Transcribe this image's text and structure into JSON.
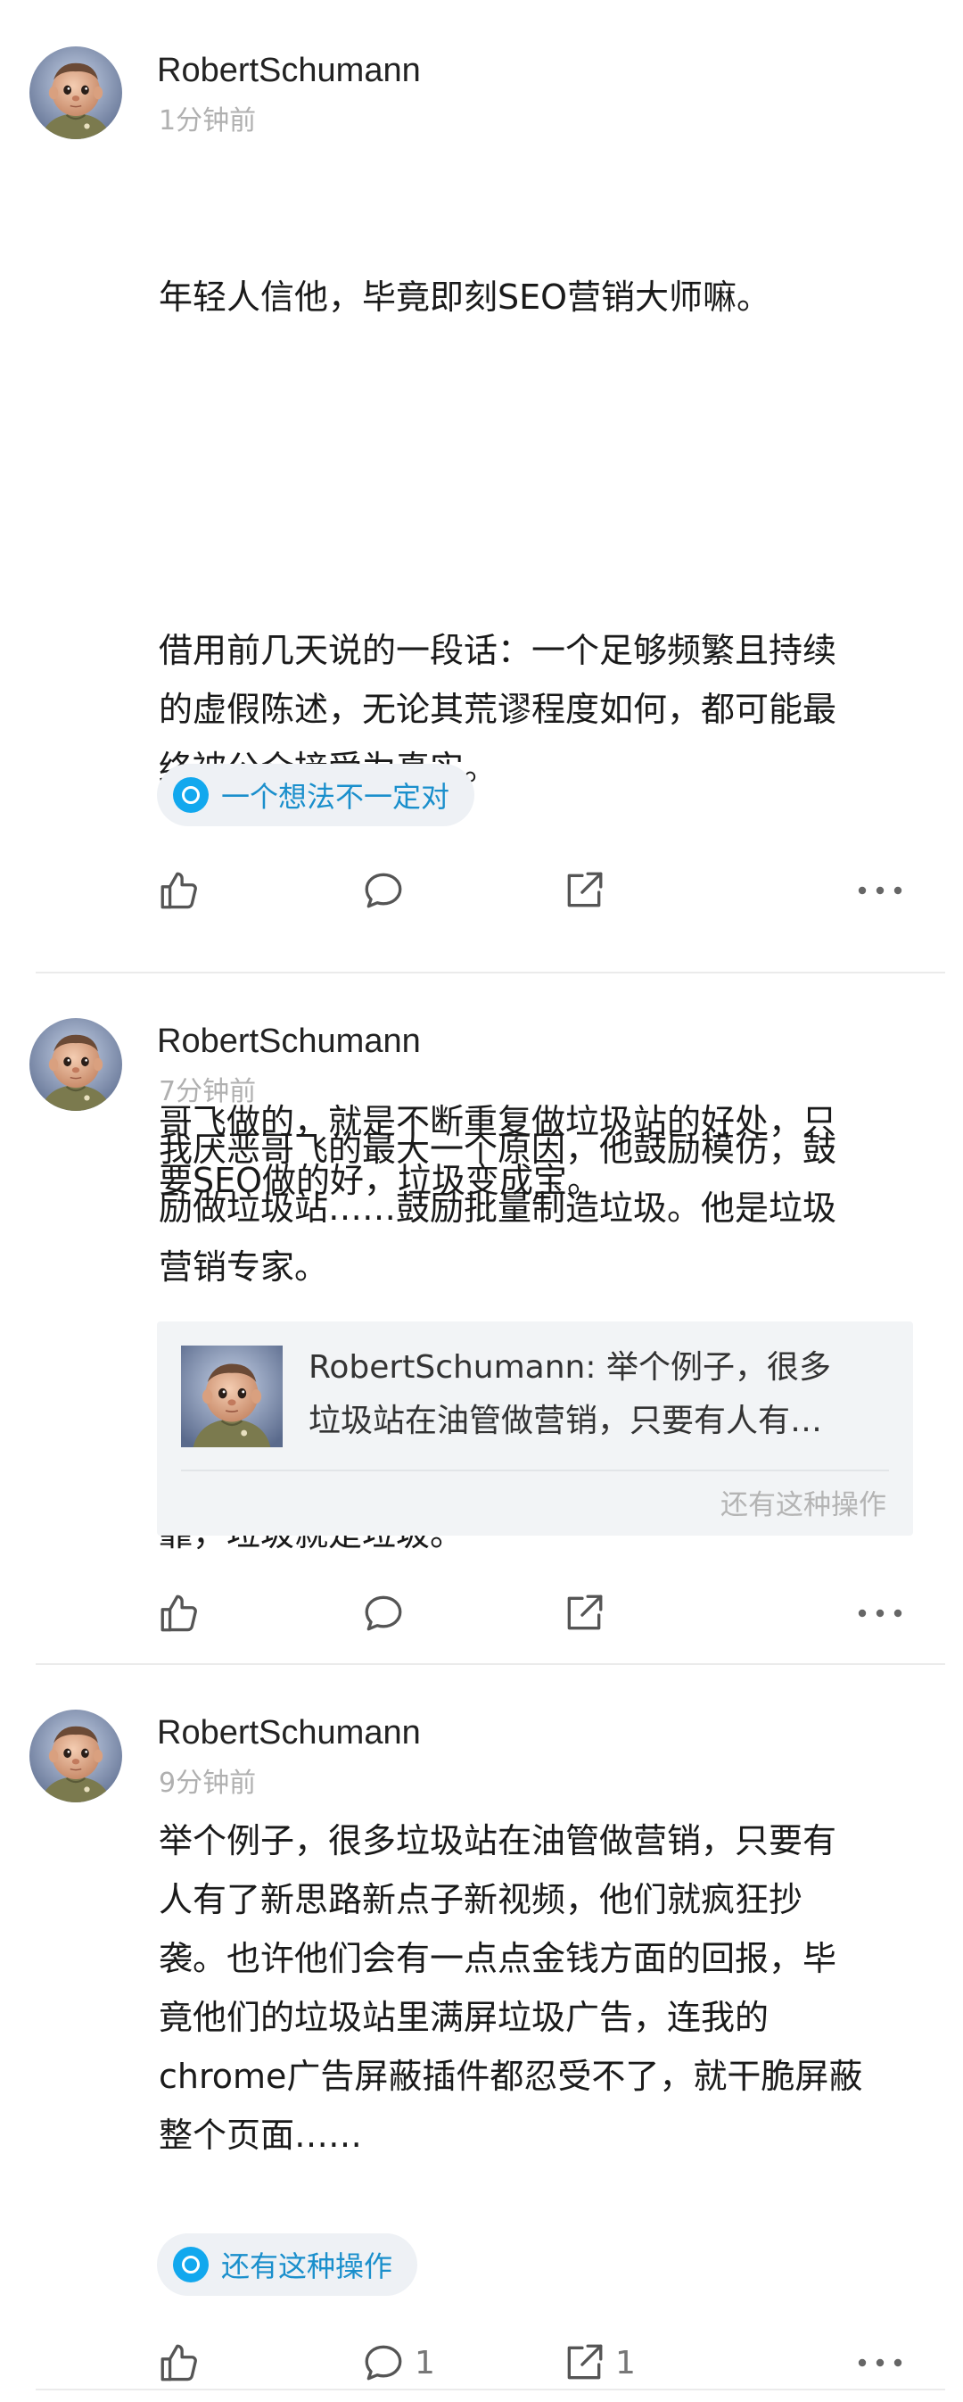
{
  "posts": [
    {
      "author": "RobertSchumann",
      "time": "1分钟前",
      "paragraphs": [
        "年轻人信他，毕竟即刻SEO营销大师嘛。",
        "借用前几天说的一段话：一个足够频繁且持续\n的虚假陈述，无论其荒谬程度如何，都可能最\n终被公众接受为真实。",
        "哥飞做的，就是不断重复做垃圾站的好处，只\n要SEO做的好，垃圾变成宝。",
        "靠，垃圾就是垃圾。"
      ],
      "tag": "一个想法不一定对",
      "comment_count": "",
      "share_count": ""
    },
    {
      "author": "RobertSchumann",
      "time": "7分钟前",
      "body": "我厌恶哥飞的最大一个原因，他鼓励模仿，鼓\n励做垃圾站……鼓励批量制造垃圾。他是垃圾\n营销专家。",
      "quote": {
        "text": "RobertSchumann: 举个例子，很多\n垃圾站在油管做营销，只要有人有…",
        "footer": "还有这种操作"
      },
      "comment_count": "",
      "share_count": ""
    },
    {
      "author": "RobertSchumann",
      "time": "9分钟前",
      "body": "举个例子，很多垃圾站在油管做营销，只要有\n人有了新思路新点子新视频，他们就疯狂抄\n袭。也许他们会有一点点金钱方面的回报，毕\n竟他们的垃圾站里满屏垃圾广告，连我的\nchrome广告屏蔽插件都忍受不了，就干脆屏蔽\n整个页面……",
      "tag": "还有这种操作",
      "comment_count": "1",
      "share_count": "1"
    }
  ],
  "icons": {
    "like": "thumbs-up-icon",
    "comment": "comment-bubble-icon",
    "share": "share-icon",
    "more": "more-dots-icon",
    "tag": "topic-circle-icon"
  },
  "colors": {
    "accent": "#12a8ee",
    "tag_text": "#1a8fcc",
    "tag_bg": "#eef1f5",
    "muted": "#b0b0b0"
  }
}
